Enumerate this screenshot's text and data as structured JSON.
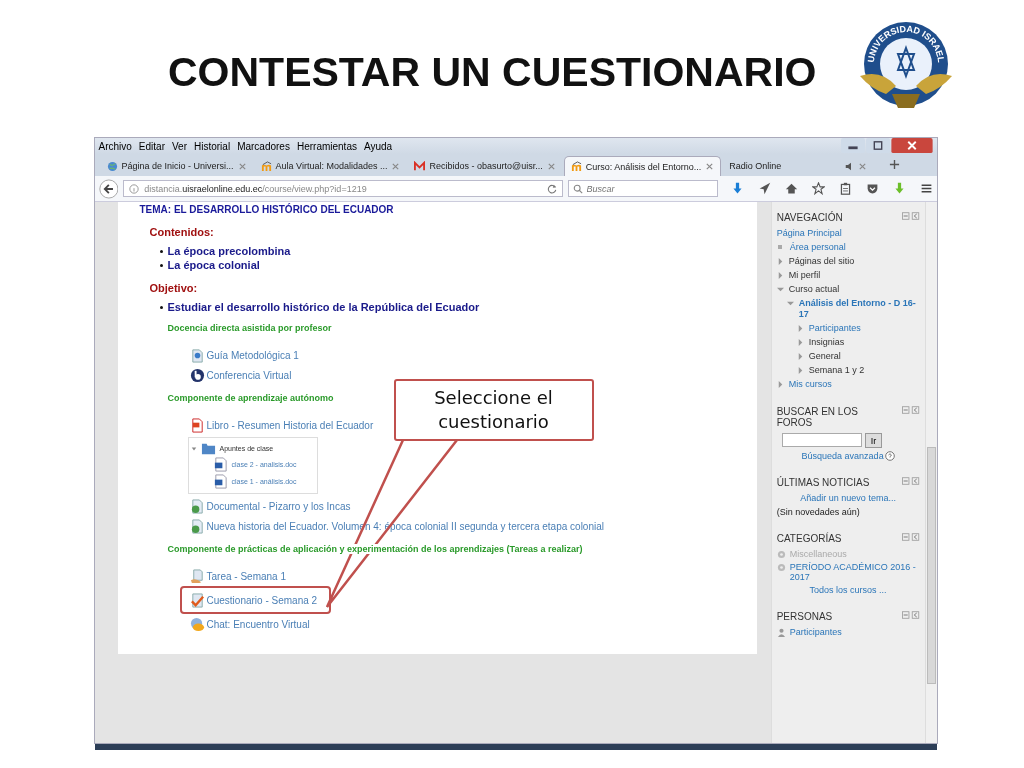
{
  "slide": {
    "title": "CONTESTAR UN CUESTIONARIO",
    "logo_text": "UNIVERSIDAD ISRAEL"
  },
  "browser": {
    "menu": [
      "Archivo",
      "Editar",
      "Ver",
      "Historial",
      "Marcadores",
      "Herramientas",
      "Ayuda"
    ],
    "tabs": [
      {
        "label": "Página de Inicio - Universi...",
        "selected": false,
        "kind": "globe"
      },
      {
        "label": "Aula Virtual: Modalidades ...",
        "selected": false,
        "kind": "moodle"
      },
      {
        "label": "Recibidos - obasurto@uisr...",
        "selected": false,
        "kind": "mail"
      },
      {
        "label": "Curso: Análisis del Entorno...",
        "selected": true,
        "kind": "moodle"
      },
      {
        "label": "Radio Online",
        "selected": false,
        "kind": "audio"
      }
    ],
    "url": "distancia.**uisraelonline.edu.ec**/course/view.php?id=1219",
    "search": {
      "placeholder": "Buscar"
    }
  },
  "course": [
    {
      "kind": "topic",
      "text": "TEMA: EL DESARROLLO HISTÓRICO DEL ECUADOR"
    },
    {
      "kind": "heading",
      "text": "Contenidos:"
    },
    {
      "kind": "bullet",
      "text": "La época precolombina"
    },
    {
      "kind": "bullet",
      "text": "La época colonial"
    },
    {
      "kind": "heading",
      "text": "Objetivo:"
    },
    {
      "kind": "bullet",
      "text": "Estudiar el desarrollo histórico de la República del Ecuador"
    },
    {
      "kind": "section",
      "text": "Docencia directa asistida por profesor"
    },
    {
      "kind": "page",
      "text": "Guía Metodológica 1",
      "highlighted": false
    },
    {
      "kind": "conference",
      "text": "Conferencia Virtual",
      "highlighted": false
    },
    {
      "kind": "section",
      "text": "Componente  de aprendizaje autónomo"
    },
    {
      "kind": "pdf",
      "text": "Libro - Resumen Historia del Ecuador",
      "highlighted": false
    },
    {
      "kind": "folder",
      "text": "Apuntes de clase",
      "expanded": true,
      "files": [
        "clase 2 - analisis.doc",
        "clase 1 - análisis.doc"
      ]
    },
    {
      "kind": "url",
      "text": "Documental - Pizarro y los Incas",
      "highlighted": false
    },
    {
      "kind": "url",
      "text": "Nueva historia del Ecuador. Volumen 4: época colonial II segunda y tercera etapa colonial",
      "highlighted": false
    },
    {
      "kind": "section",
      "text": "Componente de prácticas de aplicación y experimentación de los aprendizajes (Tareas a realizar)"
    },
    {
      "kind": "assign",
      "text": "Tarea - Semana 1",
      "highlighted": false
    },
    {
      "kind": "quiz",
      "text": "Cuestionario - Semana 2",
      "highlighted": true
    },
    {
      "kind": "chat",
      "text": "Chat: Encuentro Virtual",
      "highlighted": false
    }
  ],
  "callout": {
    "text": "Seleccione el cuestionario"
  },
  "sidebar": [
    {
      "kind": "nav",
      "title": "NAVEGACIÓN",
      "items": [
        {
          "kind": "root",
          "label": "Página Principal",
          "link": true,
          "bold": false
        },
        {
          "kind": "leaf",
          "label": "Área personal",
          "link": true,
          "bold": false
        },
        {
          "kind": "branch",
          "label": "Páginas del sitio",
          "link": false,
          "bold": false,
          "expanded": false
        },
        {
          "kind": "branch",
          "label": "Mi perfil",
          "link": false,
          "bold": false,
          "expanded": false
        },
        {
          "kind": "branch",
          "label": "Curso actual",
          "link": false,
          "bold": false,
          "expanded": true,
          "children": [
            {
              "kind": "branch",
              "label": "Análisis del Entorno - D 16-17",
              "link": true,
              "bold": true,
              "expanded": true,
              "children": [
                {
                  "kind": "branch",
                  "label": "Participantes",
                  "link": true,
                  "bold": false,
                  "expanded": false
                },
                {
                  "kind": "branch",
                  "label": "Insignias",
                  "link": false,
                  "bold": false,
                  "expanded": false
                },
                {
                  "kind": "branch",
                  "label": "General",
                  "link": false,
                  "bold": false,
                  "expanded": false
                },
                {
                  "kind": "branch",
                  "label": "Semana 1 y 2",
                  "link": false,
                  "bold": false,
                  "expanded": false
                }
              ]
            }
          ]
        },
        {
          "kind": "branch",
          "label": "Mis cursos",
          "link": true,
          "bold": false,
          "expanded": false
        }
      ]
    },
    {
      "kind": "search",
      "title": "BUSCAR EN LOS FOROS",
      "button": "Ir",
      "link": "Búsqueda avanzada"
    },
    {
      "kind": "news",
      "title": "ÚLTIMAS NOTICIAS",
      "link": "Añadir un nuevo tema...",
      "text": "(Sin novedades aún)"
    },
    {
      "kind": "categories",
      "title": "CATEGORÍAS",
      "items": [
        {
          "label": "Miscellaneous",
          "disabled": true
        },
        {
          "label": "PERÍODO ACADÉMICO 2016 - 2017",
          "disabled": false
        }
      ],
      "link": "Todos los cursos ..."
    },
    {
      "kind": "people",
      "title": "PERSONAS",
      "link": "Participantes"
    }
  ]
}
